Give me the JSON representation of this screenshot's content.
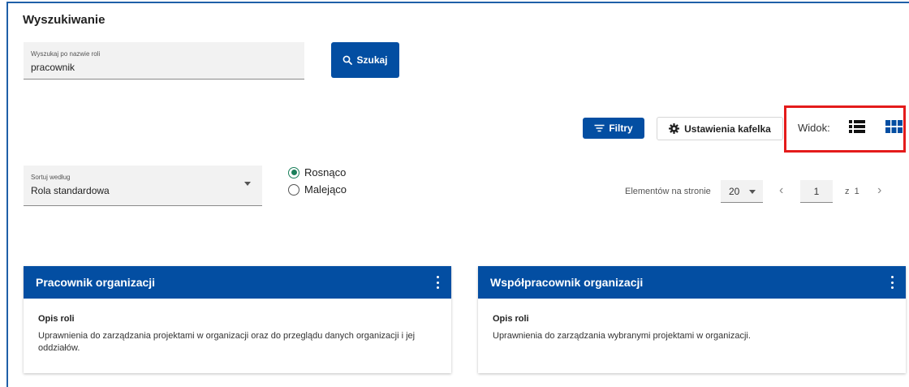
{
  "search": {
    "heading": "Wyszukiwanie",
    "field_label": "Wyszukaj po nazwie roli",
    "field_value": "pracownik",
    "button_label": "Szukaj"
  },
  "toolbar": {
    "filter_label": "Filtry",
    "tile_settings_label": "Ustawienia kafelka",
    "view_label": "Widok:"
  },
  "sort": {
    "label": "Sortuj według",
    "value": "Rola standardowa",
    "order_options": [
      {
        "label": "Rosnąco",
        "checked": true
      },
      {
        "label": "Malejąco",
        "checked": false
      }
    ]
  },
  "pagination": {
    "per_page_label": "Elementów na stronie",
    "per_page_value": "20",
    "current_page": "1",
    "of_label": "z",
    "total_pages": "1"
  },
  "cards": [
    {
      "title": "Pracownik organizacji",
      "subtitle": "Opis roli",
      "description": "Uprawnienia do zarządzania projektami w organizacji oraz do przeglądu danych organizacji i jej oddziałów."
    },
    {
      "title": "Współpracownik organizacji",
      "subtitle": "Opis roli",
      "description": "Uprawnienia do zarządzania wybranymi projektami w organizacji."
    }
  ],
  "colors": {
    "primary": "#034ea2",
    "highlight": "#e41b1b",
    "radio_checked": "#1a7f5a"
  }
}
